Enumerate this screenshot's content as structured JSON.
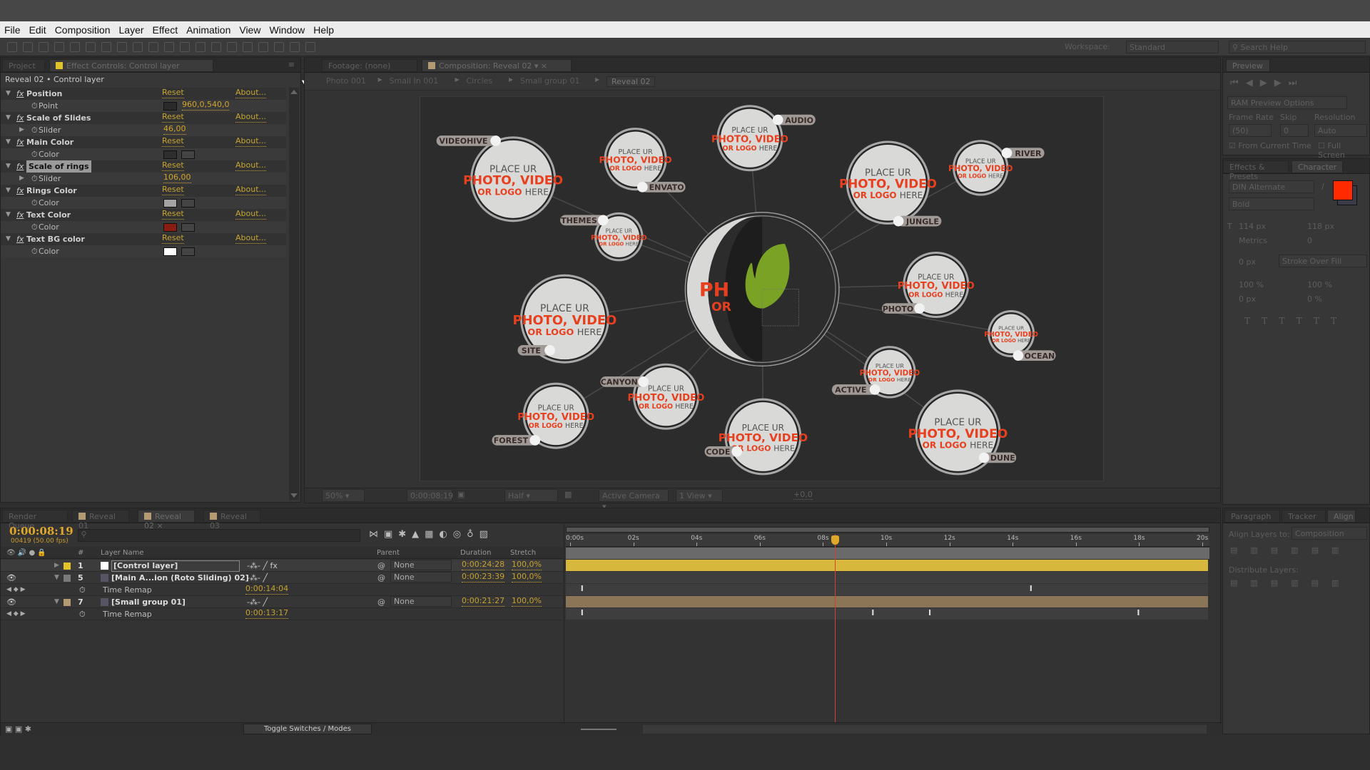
{
  "menu": [
    "File",
    "Edit",
    "Composition",
    "Layer",
    "Effect",
    "Animation",
    "View",
    "Window",
    "Help"
  ],
  "workspace": {
    "label": "Workspace:",
    "value": "Standard",
    "search_placeholder": "Search Help"
  },
  "left_panel": {
    "tabs": [
      "Project",
      "Effect Controls: Control layer"
    ],
    "header": "Reveal 02 • Control layer",
    "effects": [
      {
        "name": "Position",
        "reset": "Reset",
        "about": "About...",
        "param": "Point",
        "value": "960,0,540,0",
        "type": "point"
      },
      {
        "name": "Scale of Slides",
        "reset": "Reset",
        "about": "About...",
        "param": "Slider",
        "value": "46,00",
        "type": "slider"
      },
      {
        "name": "Main Color",
        "reset": "Reset",
        "about": "About...",
        "param": "Color",
        "color": "#2e2e2e",
        "type": "color"
      },
      {
        "name": "Scale of rings",
        "reset": "Reset",
        "about": "About...",
        "param": "Slider",
        "value": "106,00",
        "type": "slider",
        "selected": true
      },
      {
        "name": "Rings Color",
        "reset": "Reset",
        "about": "About...",
        "param": "Color",
        "color": "#a3a3a3",
        "type": "color"
      },
      {
        "name": "Text Color",
        "reset": "Reset",
        "about": "About...",
        "param": "Color",
        "color": "#8a1d12",
        "type": "color"
      },
      {
        "name": "Text BG color",
        "reset": "Reset",
        "about": "About...",
        "param": "Color",
        "color": "#ffffff",
        "type": "color"
      }
    ]
  },
  "comp_panel": {
    "tabs": [
      "Footage: (none)",
      "Composition: Reveal 02"
    ],
    "breadcrumbs": [
      "Photo 001",
      "Small In 001",
      "Circles",
      "Small group 01",
      "Reveal 02"
    ],
    "center_text": [
      "PH",
      "OR"
    ],
    "bubble_text": {
      "line1": "PLACE UR",
      "line2": "PHOTO, VIDEO",
      "line3a": "OR LOGO",
      "line3b": "HERE"
    },
    "bubbles": [
      "VIDEOHIVE",
      "ENVATO",
      "AUDIO",
      "JUNGLE",
      "RIVER",
      "THEMES",
      "SITE",
      "PHOTO",
      "OCEAN",
      "ACTIVE",
      "CANYON",
      "FOREST",
      "CODE",
      "DUNE"
    ],
    "colors": {
      "accent_red": "#e8401f",
      "leaf_green": "#7aa326",
      "bg": "#2c2c2c"
    },
    "bottom_bar": {
      "zoom": "50%",
      "timecode": "0:00:08:19",
      "resolution": "Half",
      "camera": "Active Camera",
      "views": "1 View",
      "exposure": "+0,0"
    }
  },
  "right_panel": {
    "preview": {
      "tab": "Preview",
      "ram_options": "RAM Preview Options",
      "frame_rate_label": "Frame Rate",
      "skip_label": "Skip",
      "resolution_label": "Resolution",
      "frame_rate": "(50)",
      "skip": "0",
      "resolution": "Auto",
      "from_current_time": "From Current Time",
      "from_current_checked": true,
      "full_screen": "Full Screen",
      "full_screen_checked": false
    },
    "character": {
      "tabs": [
        "Effects & Presets",
        "Character"
      ],
      "font": "DIN Alternate",
      "style": "Bold",
      "size": "114 px",
      "leading": "118 px",
      "kerning": "Metrics",
      "tracking": "0",
      "stroke": "0 px",
      "stroke_mode": "Stroke Over Fill",
      "vscale": "100 %",
      "hscale": "100 %",
      "baseline": "0 px",
      "tsume": "0 %",
      "fill_color": "#ff2a00"
    },
    "align": {
      "tabs": [
        "Paragraph",
        "Tracker",
        "Align"
      ],
      "align_to_label": "Align Layers to:",
      "align_to": "Composition",
      "distribute_label": "Distribute Layers:"
    }
  },
  "timeline": {
    "tabs": [
      "Render Queue",
      "Reveal 01",
      "Reveal 02",
      "Reveal 03"
    ],
    "timecode": "0:00:08:19",
    "frames": "00419 (50.00 fps)",
    "columns": {
      "num": "#",
      "name": "Layer Name",
      "parent": "Parent",
      "duration": "Duration",
      "stretch": "Stretch"
    },
    "ruler": [
      "0:00s",
      "02s",
      "04s",
      "06s",
      "08s",
      "10s",
      "12s",
      "14s",
      "16s",
      "18s",
      "20s"
    ],
    "current_time_s": 8.38,
    "duration_s": 20,
    "layers": [
      {
        "num": "1",
        "name": "[Control layer]",
        "parent": "None",
        "duration": "0:00:24:28",
        "stretch": "100,0%",
        "label_color": "#e2c42a"
      },
      {
        "num": "5",
        "name": "[Main A...ion (Roto Sliding) 02]",
        "parent": "None",
        "duration": "0:00:23:39",
        "stretch": "100,0%",
        "label_color": "#7a7a7a",
        "remap": "0:00:14:04",
        "remap_label": "Time Remap"
      },
      {
        "num": "7",
        "name": "[Small group 01]",
        "parent": "None",
        "duration": "0:00:21:27",
        "stretch": "100,0%",
        "label_color": "#b39a70",
        "remap": "0:00:13:17",
        "remap_label": "Time Remap"
      }
    ],
    "toggle": "Toggle Switches / Modes"
  }
}
